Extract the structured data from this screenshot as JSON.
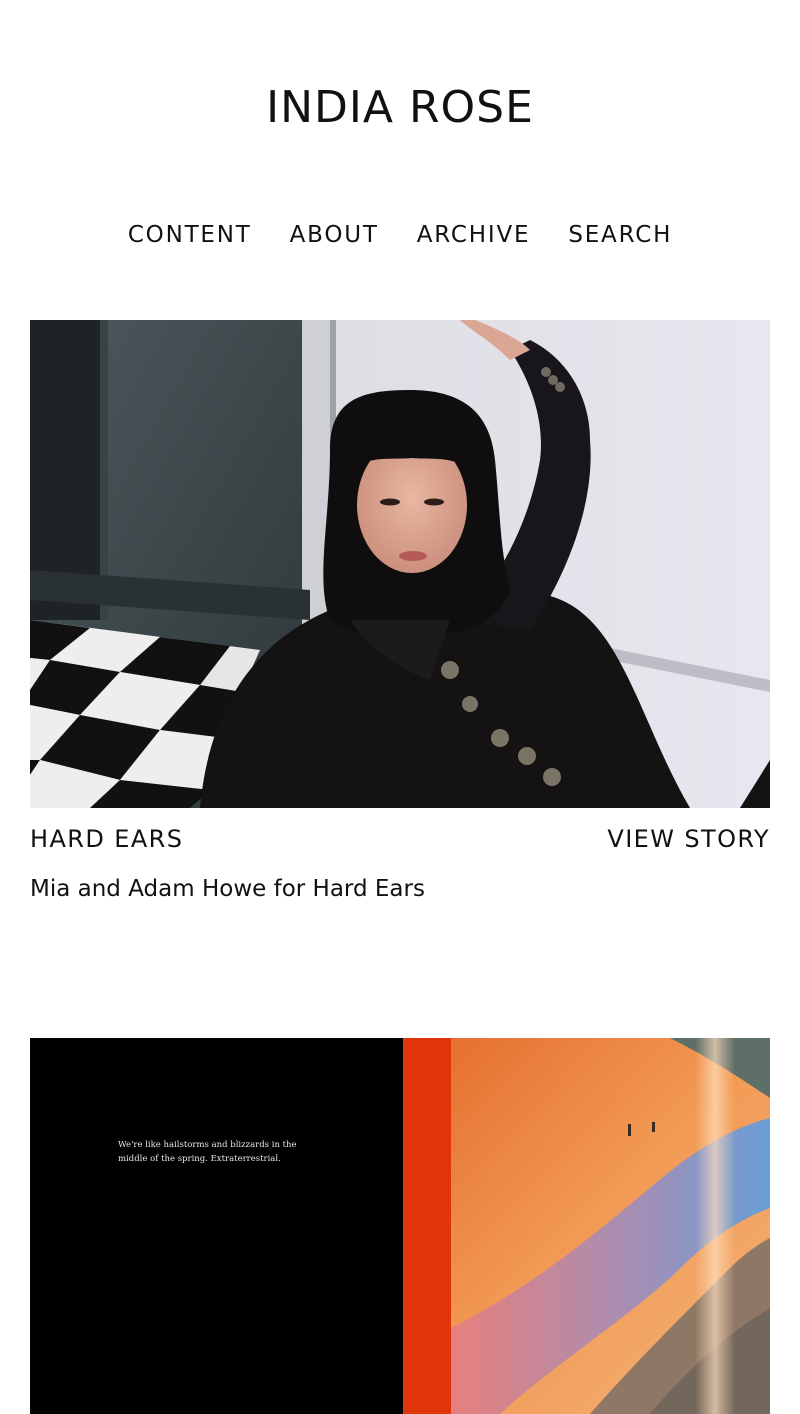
{
  "site": {
    "title": "INDIA ROSE"
  },
  "nav": {
    "items": [
      {
        "label": "CONTENT"
      },
      {
        "label": "ABOUT"
      },
      {
        "label": "ARCHIVE"
      },
      {
        "label": "SEARCH"
      }
    ]
  },
  "stories": [
    {
      "title": "HARD EARS",
      "link_label": "VIEW STORY",
      "caption": "Mia and Adam Howe for Hard Ears",
      "photo_icon": "portrait-photo"
    },
    {
      "photo_text": "We're like hailstorms and blizzards in the middle of the spring. Extraterrestrial.",
      "photo_icon": "landscape-spread-photo"
    }
  ]
}
